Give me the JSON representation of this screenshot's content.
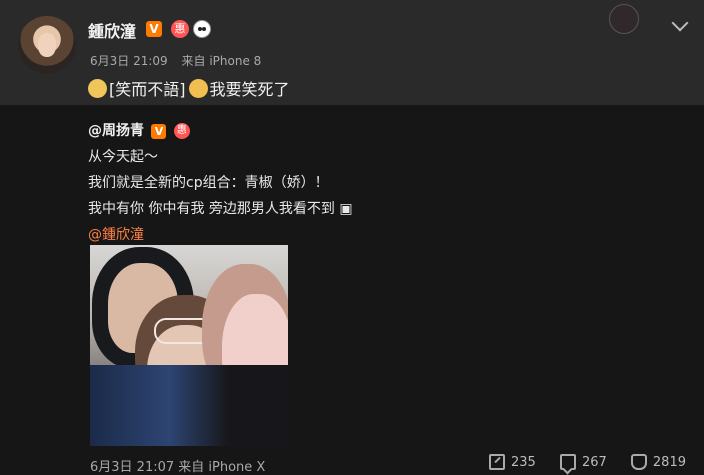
{
  "post": {
    "username": "鍾欣潼",
    "verified_mark": "V",
    "time": "6月3日 21:09",
    "source": "来自 iPhone 8",
    "content": "[笑而不語]",
    "content_tail": "我要笑死了",
    "icons": [
      "vip-badge-icon",
      "panda-icon",
      "chevron-down-icon"
    ]
  },
  "repost": {
    "handle": "@周扬青",
    "verified_mark": "V",
    "line1": "从今天起～",
    "line2": "我们就是全新的cp组合：青椒（娇）！",
    "line3": "我中有你 你中有我 旁边那男人我看不到",
    "mention": "@鍾欣潼"
  },
  "footer": {
    "time": "6月3日 21:07 来自 iPhone X"
  },
  "actions": {
    "share": "235",
    "comment": "267",
    "like": "2819"
  }
}
